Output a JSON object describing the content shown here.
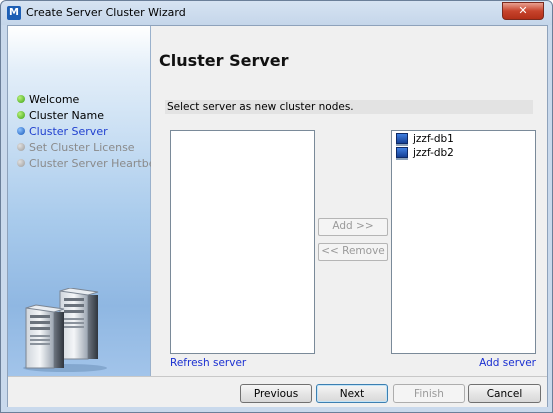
{
  "window": {
    "title": "Create Server Cluster Wizard",
    "close_label": "✕"
  },
  "sidebar": {
    "steps": [
      {
        "label": "Welcome",
        "state": "done"
      },
      {
        "label": "Cluster Name",
        "state": "done"
      },
      {
        "label": "Cluster Server",
        "state": "current"
      },
      {
        "label": "Set Cluster License",
        "state": "pending"
      },
      {
        "label": "Cluster Server Heartbeat",
        "state": "pending"
      }
    ]
  },
  "main": {
    "title": "Cluster Server",
    "instruction": "Select server as new cluster nodes.",
    "available_servers": [],
    "selected_servers": [
      "jzzf-db1",
      "jzzf-db2"
    ],
    "add_label": "Add >>",
    "remove_label": "<< Remove",
    "refresh_link": "Refresh server",
    "add_server_link": "Add server"
  },
  "footer": {
    "previous": "Previous",
    "next": "Next",
    "finish": "Finish",
    "cancel": "Cancel"
  },
  "colors": {
    "link": "#1a2fd1",
    "current_step": "#1f3fcf",
    "done_dot": "#3aa213",
    "current_dot": "#1657b8",
    "pending_dot": "#9a9a9a"
  }
}
